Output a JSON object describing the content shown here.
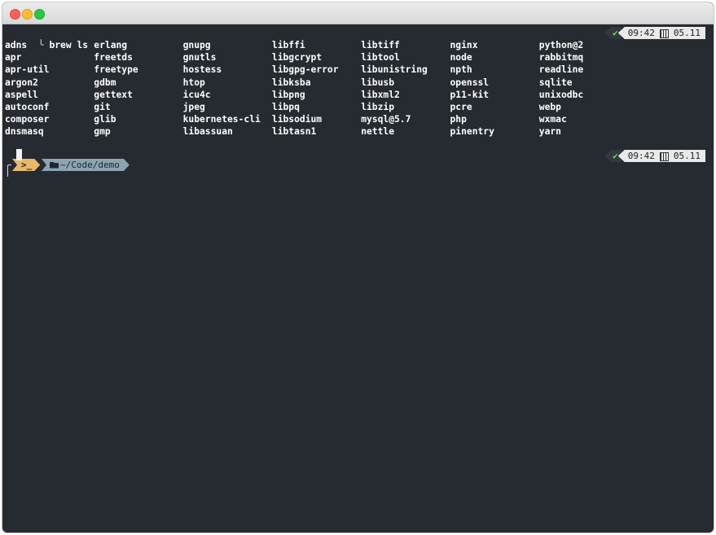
{
  "terminal": {
    "command": "brew ls",
    "corner": "╰",
    "listing": [
      "adns",
      "erlang",
      "gnupg",
      "libffi",
      "libtiff",
      "nginx",
      "python@2",
      "apr",
      "freetds",
      "gnutls",
      "libgcrypt",
      "libtool",
      "node",
      "rabbitmq",
      "apr-util",
      "freetype",
      "hostess",
      "libgpg-error",
      "libunistring",
      "npth",
      "readline",
      "argon2",
      "gdbm",
      "htop",
      "libksba",
      "libusb",
      "openssl",
      "sqlite",
      "aspell",
      "gettext",
      "icu4c",
      "libpng",
      "libxml2",
      "p11-kit",
      "unixodbc",
      "autoconf",
      "git",
      "jpeg",
      "libpq",
      "libzip",
      "pcre",
      "webp",
      "composer",
      "glib",
      "kubernetes-cli",
      "libsodium",
      "mysql@5.7",
      "php",
      "wxmac",
      "dnsmasq",
      "gmp",
      "libassuan",
      "libtasn1",
      "nettle",
      "pinentry",
      "yarn"
    ],
    "status_top": {
      "check": "✔",
      "time": "09:42",
      "date": "05.11"
    },
    "status_bottom": {
      "check": "✔",
      "time": "09:42",
      "date": "05.11"
    },
    "prompt": {
      "shell_symbol": ">_",
      "directory": "~/Code/demo"
    }
  },
  "colors": {
    "background": "#262a31",
    "prompt_shell": "#e8b86a",
    "prompt_dir": "#8da3b0",
    "status_ok": "#7fd26a"
  }
}
